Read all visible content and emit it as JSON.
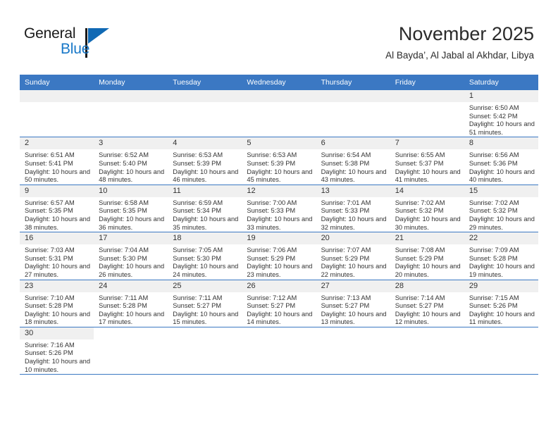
{
  "brand": {
    "word1": "General",
    "word2": "Blue",
    "icon": "triangle-logo",
    "accent_color": "#1069b4"
  },
  "header": {
    "title": "November 2025",
    "subtitle": "Al Bayda’, Al Jabal al Akhdar, Libya"
  },
  "theme": {
    "header_blue": "#3b78c3",
    "daynum_gray": "#f0f0f0",
    "text": "#333333"
  },
  "calendar": {
    "weekday_headers": [
      "Sunday",
      "Monday",
      "Tuesday",
      "Wednesday",
      "Thursday",
      "Friday",
      "Saturday"
    ],
    "weeks": [
      [
        {
          "day": "",
          "type": "blank"
        },
        {
          "day": "",
          "type": "blank"
        },
        {
          "day": "",
          "type": "blank"
        },
        {
          "day": "",
          "type": "blank"
        },
        {
          "day": "",
          "type": "blank"
        },
        {
          "day": "",
          "type": "blank"
        },
        {
          "day": "1",
          "sunrise": "Sunrise: 6:50 AM",
          "sunset": "Sunset: 5:42 PM",
          "daylight": "Daylight: 10 hours and 51 minutes."
        }
      ],
      [
        {
          "day": "2",
          "sunrise": "Sunrise: 6:51 AM",
          "sunset": "Sunset: 5:41 PM",
          "daylight": "Daylight: 10 hours and 50 minutes."
        },
        {
          "day": "3",
          "sunrise": "Sunrise: 6:52 AM",
          "sunset": "Sunset: 5:40 PM",
          "daylight": "Daylight: 10 hours and 48 minutes."
        },
        {
          "day": "4",
          "sunrise": "Sunrise: 6:53 AM",
          "sunset": "Sunset: 5:39 PM",
          "daylight": "Daylight: 10 hours and 46 minutes."
        },
        {
          "day": "5",
          "sunrise": "Sunrise: 6:53 AM",
          "sunset": "Sunset: 5:39 PM",
          "daylight": "Daylight: 10 hours and 45 minutes."
        },
        {
          "day": "6",
          "sunrise": "Sunrise: 6:54 AM",
          "sunset": "Sunset: 5:38 PM",
          "daylight": "Daylight: 10 hours and 43 minutes."
        },
        {
          "day": "7",
          "sunrise": "Sunrise: 6:55 AM",
          "sunset": "Sunset: 5:37 PM",
          "daylight": "Daylight: 10 hours and 41 minutes."
        },
        {
          "day": "8",
          "sunrise": "Sunrise: 6:56 AM",
          "sunset": "Sunset: 5:36 PM",
          "daylight": "Daylight: 10 hours and 40 minutes."
        }
      ],
      [
        {
          "day": "9",
          "sunrise": "Sunrise: 6:57 AM",
          "sunset": "Sunset: 5:35 PM",
          "daylight": "Daylight: 10 hours and 38 minutes."
        },
        {
          "day": "10",
          "sunrise": "Sunrise: 6:58 AM",
          "sunset": "Sunset: 5:35 PM",
          "daylight": "Daylight: 10 hours and 36 minutes."
        },
        {
          "day": "11",
          "sunrise": "Sunrise: 6:59 AM",
          "sunset": "Sunset: 5:34 PM",
          "daylight": "Daylight: 10 hours and 35 minutes."
        },
        {
          "day": "12",
          "sunrise": "Sunrise: 7:00 AM",
          "sunset": "Sunset: 5:33 PM",
          "daylight": "Daylight: 10 hours and 33 minutes."
        },
        {
          "day": "13",
          "sunrise": "Sunrise: 7:01 AM",
          "sunset": "Sunset: 5:33 PM",
          "daylight": "Daylight: 10 hours and 32 minutes."
        },
        {
          "day": "14",
          "sunrise": "Sunrise: 7:02 AM",
          "sunset": "Sunset: 5:32 PM",
          "daylight": "Daylight: 10 hours and 30 minutes."
        },
        {
          "day": "15",
          "sunrise": "Sunrise: 7:02 AM",
          "sunset": "Sunset: 5:32 PM",
          "daylight": "Daylight: 10 hours and 29 minutes."
        }
      ],
      [
        {
          "day": "16",
          "sunrise": "Sunrise: 7:03 AM",
          "sunset": "Sunset: 5:31 PM",
          "daylight": "Daylight: 10 hours and 27 minutes."
        },
        {
          "day": "17",
          "sunrise": "Sunrise: 7:04 AM",
          "sunset": "Sunset: 5:30 PM",
          "daylight": "Daylight: 10 hours and 26 minutes."
        },
        {
          "day": "18",
          "sunrise": "Sunrise: 7:05 AM",
          "sunset": "Sunset: 5:30 PM",
          "daylight": "Daylight: 10 hours and 24 minutes."
        },
        {
          "day": "19",
          "sunrise": "Sunrise: 7:06 AM",
          "sunset": "Sunset: 5:29 PM",
          "daylight": "Daylight: 10 hours and 23 minutes."
        },
        {
          "day": "20",
          "sunrise": "Sunrise: 7:07 AM",
          "sunset": "Sunset: 5:29 PM",
          "daylight": "Daylight: 10 hours and 22 minutes."
        },
        {
          "day": "21",
          "sunrise": "Sunrise: 7:08 AM",
          "sunset": "Sunset: 5:29 PM",
          "daylight": "Daylight: 10 hours and 20 minutes."
        },
        {
          "day": "22",
          "sunrise": "Sunrise: 7:09 AM",
          "sunset": "Sunset: 5:28 PM",
          "daylight": "Daylight: 10 hours and 19 minutes."
        }
      ],
      [
        {
          "day": "23",
          "sunrise": "Sunrise: 7:10 AM",
          "sunset": "Sunset: 5:28 PM",
          "daylight": "Daylight: 10 hours and 18 minutes."
        },
        {
          "day": "24",
          "sunrise": "Sunrise: 7:11 AM",
          "sunset": "Sunset: 5:28 PM",
          "daylight": "Daylight: 10 hours and 17 minutes."
        },
        {
          "day": "25",
          "sunrise": "Sunrise: 7:11 AM",
          "sunset": "Sunset: 5:27 PM",
          "daylight": "Daylight: 10 hours and 15 minutes."
        },
        {
          "day": "26",
          "sunrise": "Sunrise: 7:12 AM",
          "sunset": "Sunset: 5:27 PM",
          "daylight": "Daylight: 10 hours and 14 minutes."
        },
        {
          "day": "27",
          "sunrise": "Sunrise: 7:13 AM",
          "sunset": "Sunset: 5:27 PM",
          "daylight": "Daylight: 10 hours and 13 minutes."
        },
        {
          "day": "28",
          "sunrise": "Sunrise: 7:14 AM",
          "sunset": "Sunset: 5:27 PM",
          "daylight": "Daylight: 10 hours and 12 minutes."
        },
        {
          "day": "29",
          "sunrise": "Sunrise: 7:15 AM",
          "sunset": "Sunset: 5:26 PM",
          "daylight": "Daylight: 10 hours and 11 minutes."
        }
      ],
      [
        {
          "day": "30",
          "sunrise": "Sunrise: 7:16 AM",
          "sunset": "Sunset: 5:26 PM",
          "daylight": "Daylight: 10 hours and 10 minutes."
        },
        {
          "day": "",
          "type": "void"
        },
        {
          "day": "",
          "type": "void"
        },
        {
          "day": "",
          "type": "void"
        },
        {
          "day": "",
          "type": "void"
        },
        {
          "day": "",
          "type": "void"
        },
        {
          "day": "",
          "type": "void"
        }
      ]
    ]
  }
}
